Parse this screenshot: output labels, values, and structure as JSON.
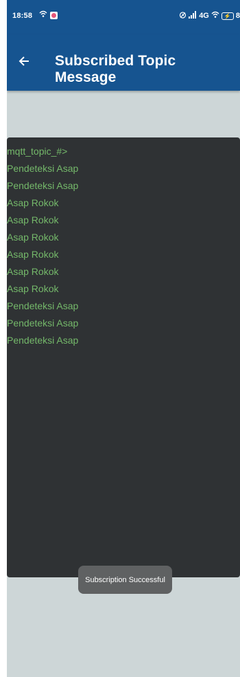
{
  "status_bar": {
    "time": "18:58",
    "right_text": "4G",
    "battery": "8"
  },
  "app_bar": {
    "title": "Subscribed Topic Message"
  },
  "terminal": {
    "lines": [
      "mqtt_topic_#>",
      "Pendeteksi Asap",
      "Pendeteksi Asap",
      "Asap Rokok",
      "Asap Rokok",
      "Asap Rokok",
      "Asap Rokok",
      "Asap Rokok",
      "Asap Rokok",
      "Pendeteksi Asap",
      "Pendeteksi Asap",
      "Pendeteksi Asap"
    ]
  },
  "toast": {
    "text": "Subscription Successful"
  },
  "colors": {
    "app_bar": "#165490",
    "background": "#cdd6d7",
    "terminal_bg": "#2f3234",
    "terminal_text": "#74b86a",
    "toast_bg": "#5f6162"
  },
  "icons": {
    "back": "arrow-left-icon",
    "wifi": "wifi-icon",
    "notification": "notification-icon",
    "alarm": "alarm-icon",
    "signal": "signal-icon",
    "battery": "battery-charging-icon"
  }
}
